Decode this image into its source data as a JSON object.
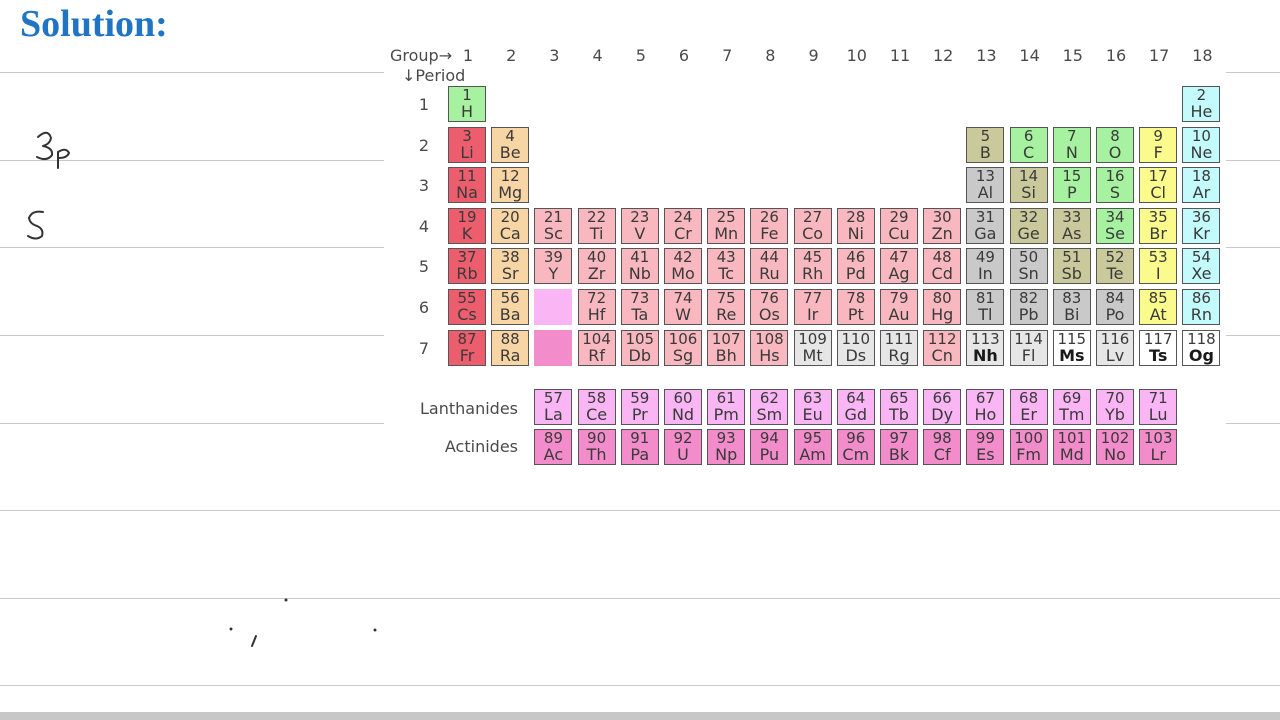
{
  "title": "Solution:",
  "table": {
    "group_label": "Group→",
    "period_label": "↓Period",
    "groups": [
      "1",
      "2",
      "3",
      "4",
      "5",
      "6",
      "7",
      "8",
      "9",
      "10",
      "11",
      "12",
      "13",
      "14",
      "15",
      "16",
      "17",
      "18"
    ],
    "periods": [
      "1",
      "2",
      "3",
      "4",
      "5",
      "6",
      "7"
    ],
    "lanthanides_label": "Lanthanides",
    "actinides_label": "Actinides",
    "elements": [
      {
        "n": "1",
        "s": "H",
        "g": 1,
        "p": 1,
        "c": "nonmetal"
      },
      {
        "n": "2",
        "s": "He",
        "g": 18,
        "p": 1,
        "c": "noble"
      },
      {
        "n": "3",
        "s": "Li",
        "g": 1,
        "p": 2,
        "c": "alkali"
      },
      {
        "n": "4",
        "s": "Be",
        "g": 2,
        "p": 2,
        "c": "alkaline"
      },
      {
        "n": "5",
        "s": "B",
        "g": 13,
        "p": 2,
        "c": "metalloid"
      },
      {
        "n": "6",
        "s": "C",
        "g": 14,
        "p": 2,
        "c": "nonmetal"
      },
      {
        "n": "7",
        "s": "N",
        "g": 15,
        "p": 2,
        "c": "nonmetal"
      },
      {
        "n": "8",
        "s": "O",
        "g": 16,
        "p": 2,
        "c": "nonmetal"
      },
      {
        "n": "9",
        "s": "F",
        "g": 17,
        "p": 2,
        "c": "halogen"
      },
      {
        "n": "10",
        "s": "Ne",
        "g": 18,
        "p": 2,
        "c": "noble"
      },
      {
        "n": "11",
        "s": "Na",
        "g": 1,
        "p": 3,
        "c": "alkali"
      },
      {
        "n": "12",
        "s": "Mg",
        "g": 2,
        "p": 3,
        "c": "alkaline"
      },
      {
        "n": "13",
        "s": "Al",
        "g": 13,
        "p": 3,
        "c": "post"
      },
      {
        "n": "14",
        "s": "Si",
        "g": 14,
        "p": 3,
        "c": "metalloid"
      },
      {
        "n": "15",
        "s": "P",
        "g": 15,
        "p": 3,
        "c": "nonmetal"
      },
      {
        "n": "16",
        "s": "S",
        "g": 16,
        "p": 3,
        "c": "nonmetal"
      },
      {
        "n": "17",
        "s": "Cl",
        "g": 17,
        "p": 3,
        "c": "halogen"
      },
      {
        "n": "18",
        "s": "Ar",
        "g": 18,
        "p": 3,
        "c": "noble"
      },
      {
        "n": "19",
        "s": "K",
        "g": 1,
        "p": 4,
        "c": "alkali"
      },
      {
        "n": "20",
        "s": "Ca",
        "g": 2,
        "p": 4,
        "c": "alkaline"
      },
      {
        "n": "21",
        "s": "Sc",
        "g": 3,
        "p": 4,
        "c": "trans"
      },
      {
        "n": "22",
        "s": "Ti",
        "g": 4,
        "p": 4,
        "c": "trans"
      },
      {
        "n": "23",
        "s": "V",
        "g": 5,
        "p": 4,
        "c": "trans"
      },
      {
        "n": "24",
        "s": "Cr",
        "g": 6,
        "p": 4,
        "c": "trans"
      },
      {
        "n": "25",
        "s": "Mn",
        "g": 7,
        "p": 4,
        "c": "trans"
      },
      {
        "n": "26",
        "s": "Fe",
        "g": 8,
        "p": 4,
        "c": "trans"
      },
      {
        "n": "27",
        "s": "Co",
        "g": 9,
        "p": 4,
        "c": "trans"
      },
      {
        "n": "28",
        "s": "Ni",
        "g": 10,
        "p": 4,
        "c": "trans"
      },
      {
        "n": "29",
        "s": "Cu",
        "g": 11,
        "p": 4,
        "c": "trans"
      },
      {
        "n": "30",
        "s": "Zn",
        "g": 12,
        "p": 4,
        "c": "trans"
      },
      {
        "n": "31",
        "s": "Ga",
        "g": 13,
        "p": 4,
        "c": "post"
      },
      {
        "n": "32",
        "s": "Ge",
        "g": 14,
        "p": 4,
        "c": "metalloid"
      },
      {
        "n": "33",
        "s": "As",
        "g": 15,
        "p": 4,
        "c": "metalloid"
      },
      {
        "n": "34",
        "s": "Se",
        "g": 16,
        "p": 4,
        "c": "nonmetal"
      },
      {
        "n": "35",
        "s": "Br",
        "g": 17,
        "p": 4,
        "c": "halogen"
      },
      {
        "n": "36",
        "s": "Kr",
        "g": 18,
        "p": 4,
        "c": "noble"
      },
      {
        "n": "37",
        "s": "Rb",
        "g": 1,
        "p": 5,
        "c": "alkali"
      },
      {
        "n": "38",
        "s": "Sr",
        "g": 2,
        "p": 5,
        "c": "alkaline"
      },
      {
        "n": "39",
        "s": "Y",
        "g": 3,
        "p": 5,
        "c": "trans"
      },
      {
        "n": "40",
        "s": "Zr",
        "g": 4,
        "p": 5,
        "c": "trans"
      },
      {
        "n": "41",
        "s": "Nb",
        "g": 5,
        "p": 5,
        "c": "trans"
      },
      {
        "n": "42",
        "s": "Mo",
        "g": 6,
        "p": 5,
        "c": "trans"
      },
      {
        "n": "43",
        "s": "Tc",
        "g": 7,
        "p": 5,
        "c": "trans"
      },
      {
        "n": "44",
        "s": "Ru",
        "g": 8,
        "p": 5,
        "c": "trans"
      },
      {
        "n": "45",
        "s": "Rh",
        "g": 9,
        "p": 5,
        "c": "trans"
      },
      {
        "n": "46",
        "s": "Pd",
        "g": 10,
        "p": 5,
        "c": "trans"
      },
      {
        "n": "47",
        "s": "Ag",
        "g": 11,
        "p": 5,
        "c": "trans"
      },
      {
        "n": "48",
        "s": "Cd",
        "g": 12,
        "p": 5,
        "c": "trans"
      },
      {
        "n": "49",
        "s": "In",
        "g": 13,
        "p": 5,
        "c": "post"
      },
      {
        "n": "50",
        "s": "Sn",
        "g": 14,
        "p": 5,
        "c": "post"
      },
      {
        "n": "51",
        "s": "Sb",
        "g": 15,
        "p": 5,
        "c": "metalloid"
      },
      {
        "n": "52",
        "s": "Te",
        "g": 16,
        "p": 5,
        "c": "metalloid"
      },
      {
        "n": "53",
        "s": "I",
        "g": 17,
        "p": 5,
        "c": "halogen"
      },
      {
        "n": "54",
        "s": "Xe",
        "g": 18,
        "p": 5,
        "c": "noble"
      },
      {
        "n": "55",
        "s": "Cs",
        "g": 1,
        "p": 6,
        "c": "alkali"
      },
      {
        "n": "56",
        "s": "Ba",
        "g": 2,
        "p": 6,
        "c": "alkaline"
      },
      {
        "n": "",
        "s": "",
        "g": 3,
        "p": 6,
        "c": "lanth"
      },
      {
        "n": "72",
        "s": "Hf",
        "g": 4,
        "p": 6,
        "c": "trans"
      },
      {
        "n": "73",
        "s": "Ta",
        "g": 5,
        "p": 6,
        "c": "trans"
      },
      {
        "n": "74",
        "s": "W",
        "g": 6,
        "p": 6,
        "c": "trans"
      },
      {
        "n": "75",
        "s": "Re",
        "g": 7,
        "p": 6,
        "c": "trans"
      },
      {
        "n": "76",
        "s": "Os",
        "g": 8,
        "p": 6,
        "c": "trans"
      },
      {
        "n": "77",
        "s": "Ir",
        "g": 9,
        "p": 6,
        "c": "trans"
      },
      {
        "n": "78",
        "s": "Pt",
        "g": 10,
        "p": 6,
        "c": "trans"
      },
      {
        "n": "79",
        "s": "Au",
        "g": 11,
        "p": 6,
        "c": "trans"
      },
      {
        "n": "80",
        "s": "Hg",
        "g": 12,
        "p": 6,
        "c": "trans"
      },
      {
        "n": "81",
        "s": "Tl",
        "g": 13,
        "p": 6,
        "c": "post"
      },
      {
        "n": "82",
        "s": "Pb",
        "g": 14,
        "p": 6,
        "c": "post"
      },
      {
        "n": "83",
        "s": "Bi",
        "g": 15,
        "p": 6,
        "c": "post"
      },
      {
        "n": "84",
        "s": "Po",
        "g": 16,
        "p": 6,
        "c": "post"
      },
      {
        "n": "85",
        "s": "At",
        "g": 17,
        "p": 6,
        "c": "halogen"
      },
      {
        "n": "86",
        "s": "Rn",
        "g": 18,
        "p": 6,
        "c": "noble"
      },
      {
        "n": "87",
        "s": "Fr",
        "g": 1,
        "p": 7,
        "c": "alkali"
      },
      {
        "n": "88",
        "s": "Ra",
        "g": 2,
        "p": 7,
        "c": "alkaline"
      },
      {
        "n": "",
        "s": "",
        "g": 3,
        "p": 7,
        "c": "actin"
      },
      {
        "n": "104",
        "s": "Rf",
        "g": 4,
        "p": 7,
        "c": "trans"
      },
      {
        "n": "105",
        "s": "Db",
        "g": 5,
        "p": 7,
        "c": "trans"
      },
      {
        "n": "106",
        "s": "Sg",
        "g": 6,
        "p": 7,
        "c": "trans"
      },
      {
        "n": "107",
        "s": "Bh",
        "g": 7,
        "p": 7,
        "c": "trans"
      },
      {
        "n": "108",
        "s": "Hs",
        "g": 8,
        "p": 7,
        "c": "trans"
      },
      {
        "n": "109",
        "s": "Mt",
        "g": 9,
        "p": 7,
        "c": "unknown"
      },
      {
        "n": "110",
        "s": "Ds",
        "g": 10,
        "p": 7,
        "c": "unknown"
      },
      {
        "n": "111",
        "s": "Rg",
        "g": 11,
        "p": 7,
        "c": "unknown"
      },
      {
        "n": "112",
        "s": "Cn",
        "g": 12,
        "p": 7,
        "c": "trans"
      },
      {
        "n": "113",
        "s": "Nh",
        "g": 13,
        "p": 7,
        "c": "unknown",
        "b": true
      },
      {
        "n": "114",
        "s": "Fl",
        "g": 14,
        "p": 7,
        "c": "unknown"
      },
      {
        "n": "115",
        "s": "Ms",
        "g": 15,
        "p": 7,
        "c": "white",
        "b": true
      },
      {
        "n": "116",
        "s": "Lv",
        "g": 16,
        "p": 7,
        "c": "unknown"
      },
      {
        "n": "117",
        "s": "Ts",
        "g": 17,
        "p": 7,
        "c": "white",
        "b": true
      },
      {
        "n": "118",
        "s": "Og",
        "g": 18,
        "p": 7,
        "c": "white",
        "b": true
      }
    ],
    "lanthanides": [
      {
        "n": "57",
        "s": "La"
      },
      {
        "n": "58",
        "s": "Ce"
      },
      {
        "n": "59",
        "s": "Pr"
      },
      {
        "n": "60",
        "s": "Nd"
      },
      {
        "n": "61",
        "s": "Pm"
      },
      {
        "n": "62",
        "s": "Sm"
      },
      {
        "n": "63",
        "s": "Eu"
      },
      {
        "n": "64",
        "s": "Gd"
      },
      {
        "n": "65",
        "s": "Tb"
      },
      {
        "n": "66",
        "s": "Dy"
      },
      {
        "n": "67",
        "s": "Ho"
      },
      {
        "n": "68",
        "s": "Er"
      },
      {
        "n": "69",
        "s": "Tm"
      },
      {
        "n": "70",
        "s": "Yb"
      },
      {
        "n": "71",
        "s": "Lu"
      }
    ],
    "actinides": [
      {
        "n": "89",
        "s": "Ac"
      },
      {
        "n": "90",
        "s": "Th"
      },
      {
        "n": "91",
        "s": "Pa"
      },
      {
        "n": "92",
        "s": "U"
      },
      {
        "n": "93",
        "s": "Np"
      },
      {
        "n": "94",
        "s": "Pu"
      },
      {
        "n": "95",
        "s": "Am"
      },
      {
        "n": "96",
        "s": "Cm"
      },
      {
        "n": "97",
        "s": "Bk"
      },
      {
        "n": "98",
        "s": "Cf"
      },
      {
        "n": "99",
        "s": "Es"
      },
      {
        "n": "100",
        "s": "Fm"
      },
      {
        "n": "101",
        "s": "Md"
      },
      {
        "n": "102",
        "s": "No"
      },
      {
        "n": "103",
        "s": "Lr"
      }
    ]
  }
}
